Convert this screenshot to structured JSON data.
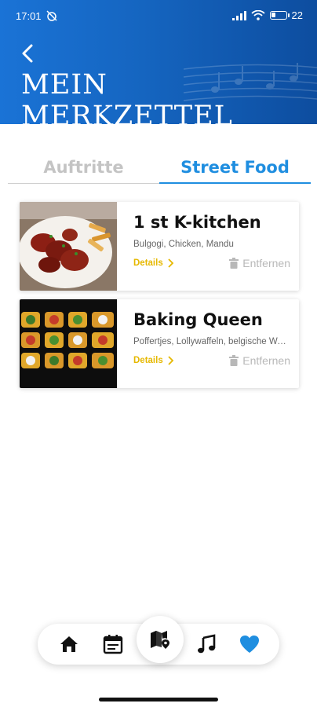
{
  "status_bar": {
    "time": "17:01",
    "battery": "22",
    "battery_level_percent": 22
  },
  "header": {
    "title": "MEIN MERKZETTEL",
    "back_icon": "chevron-left-icon",
    "background_color": "#1565c0"
  },
  "tabs": [
    {
      "label": "Auftritte",
      "selected": false
    },
    {
      "label": "Street Food",
      "selected": true
    }
  ],
  "items": [
    {
      "name": "1 st K-kitchen",
      "description": "Bulgogi, Chicken, Mandu",
      "details_label": "Details",
      "remove_label": "Entfernen"
    },
    {
      "name": "Baking Queen",
      "description": "Poffertjes, Lollywaffeln, belgische Waffeln",
      "details_label": "Details",
      "remove_label": "Entfernen"
    }
  ],
  "bottom_nav": [
    {
      "icon": "home-icon"
    },
    {
      "icon": "calendar-icon"
    },
    {
      "icon": "map-pin-icon",
      "active": true
    },
    {
      "icon": "music-note-icon"
    },
    {
      "icon": "heart-icon",
      "selected": true
    }
  ],
  "colors": {
    "accent": "#1f8ee0",
    "details": "#e6b800",
    "inactive_tab": "#c4c4c4"
  }
}
